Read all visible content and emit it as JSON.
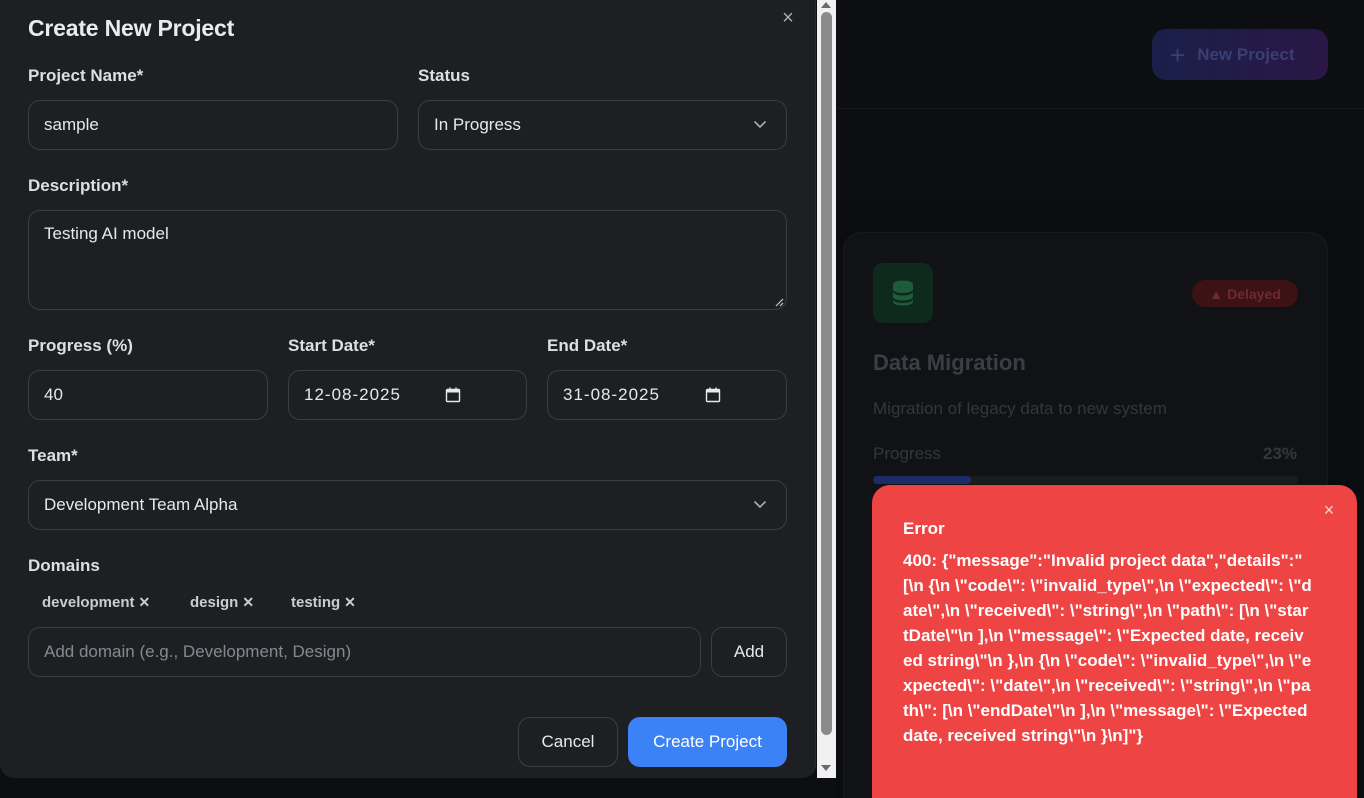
{
  "modal": {
    "title": "Create New Project",
    "close_icon": "×",
    "project_name": {
      "label": "Project Name*",
      "value": "sample"
    },
    "status": {
      "label": "Status",
      "value": "In Progress"
    },
    "description": {
      "label": "Description*",
      "value": "Testing AI model"
    },
    "progress": {
      "label": "Progress (%)",
      "value": "40"
    },
    "start_date": {
      "label": "Start Date*",
      "value": "12-08-2025"
    },
    "end_date": {
      "label": "End Date*",
      "value": "31-08-2025"
    },
    "team": {
      "label": "Team*",
      "value": "Development Team Alpha"
    },
    "domains": {
      "label": "Domains",
      "tags": [
        {
          "name": "development",
          "remove": "✕"
        },
        {
          "name": "design",
          "remove": "✕"
        },
        {
          "name": "testing",
          "remove": "✕"
        }
      ],
      "input_placeholder": "Add domain (e.g., Development, Design)",
      "add_label": "Add"
    },
    "cancel_label": "Cancel",
    "submit_label": "Create Project"
  },
  "background": {
    "new_project_label": "New Project",
    "card": {
      "icon": "database-icon",
      "badge": "Delayed",
      "title": "Data Migration",
      "description": "Migration of legacy data to new system",
      "progress_label": "Progress",
      "progress_value": "23%",
      "progress_fraction": 0.23
    }
  },
  "toast": {
    "title": "Error",
    "message": "400: {\"message\":\"Invalid project data\",\"details\":\"[\\n {\\n \\\"code\\\": \\\"invalid_type\\\",\\n \\\"expected\\\": \\\"date\\\",\\n \\\"received\\\": \\\"string\\\",\\n \\\"path\\\": [\\n \\\"startDate\\\"\\n ],\\n \\\"message\\\": \\\"Expected date, received string\\\"\\n },\\n {\\n \\\"code\\\": \\\"invalid_type\\\",\\n \\\"expected\\\": \\\"date\\\",\\n \\\"received\\\": \\\"string\\\",\\n \\\"path\\\": [\\n \\\"endDate\\\"\\n ],\\n \\\"message\\\": \\\"Expected date, received string\\\"\\n }\\n]\"}",
    "close_icon": "×"
  },
  "colors": {
    "primary": "#3b82f6",
    "error": "#ef4444",
    "modal_bg": "#1d1f22"
  }
}
